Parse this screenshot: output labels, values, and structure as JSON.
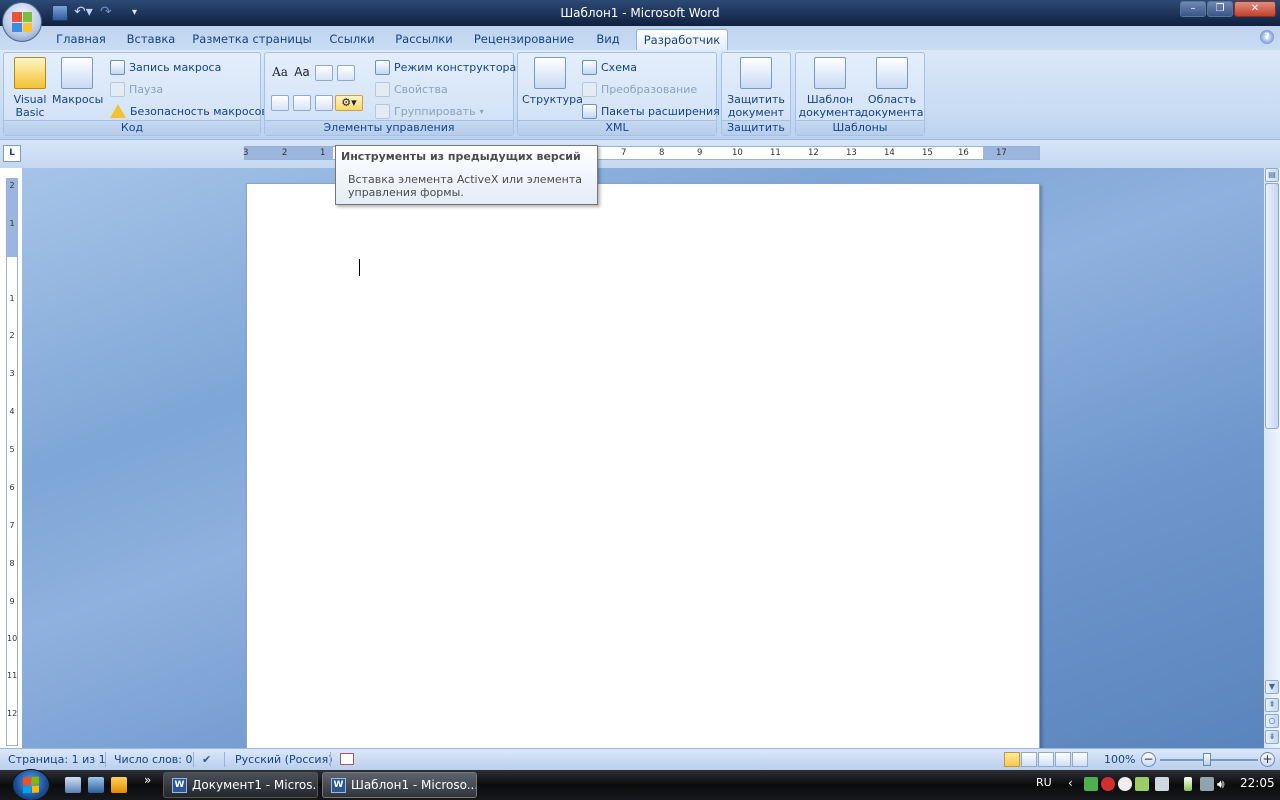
{
  "window": {
    "title": "Шаблон1 - Microsoft Word"
  },
  "quick_access": {
    "icons": [
      "save-icon",
      "undo-icon",
      "redo-icon",
      "customize-icon"
    ]
  },
  "tabs": [
    {
      "label": "Главная"
    },
    {
      "label": "Вставка"
    },
    {
      "label": "Разметка страницы"
    },
    {
      "label": "Ссылки"
    },
    {
      "label": "Рассылки"
    },
    {
      "label": "Рецензирование"
    },
    {
      "label": "Вид"
    },
    {
      "label": "Разработчик",
      "active": true
    }
  ],
  "ribbon": {
    "code": {
      "label": "Код",
      "visual_basic": "Visual\nBasic",
      "macros": "Макросы",
      "record_macro": "Запись макроса",
      "pause": "Пауза",
      "macro_security": "Безопасность макросов"
    },
    "controls": {
      "label": "Элементы управления",
      "design_mode": "Режим конструктора",
      "properties": "Свойства",
      "group": "Группировать",
      "aa1": "Aa",
      "aa2": "Aa"
    },
    "xml": {
      "label": "XML",
      "structure": "Структура",
      "schema": "Схема",
      "transform": "Преобразование",
      "expansion_packs": "Пакеты расширения"
    },
    "protect": {
      "label": "Защитить",
      "protect_doc": "Защитить\nдокумент ▾"
    },
    "templates": {
      "label": "Шаблоны",
      "doc_template": "Шаблон\nдокумента",
      "doc_panel": "Область\nдокумента"
    }
  },
  "tooltip": {
    "title": "Инструменты из предыдущих версий",
    "body": "Вставка элемента ActiveX или элемента управления формы."
  },
  "ruler": {
    "h_numbers": [
      "3",
      "2",
      "1",
      "7",
      "8",
      "9",
      "10",
      "11",
      "12",
      "13",
      "14",
      "15",
      "16",
      "17"
    ],
    "v_numbers": [
      "2",
      "1",
      "1",
      "2",
      "3",
      "4",
      "5",
      "6",
      "7",
      "8",
      "9",
      "10",
      "11",
      "12"
    ]
  },
  "status": {
    "page": "Страница: 1 из 1",
    "words": "Число слов: 0",
    "language": "Русский (Россия)",
    "zoom": "100%"
  },
  "taskbar": {
    "buttons": [
      {
        "label": "Документ1 - Micros..."
      },
      {
        "label": "Шаблон1 - Microso..."
      }
    ],
    "lang": "RU",
    "time": "22:05"
  }
}
